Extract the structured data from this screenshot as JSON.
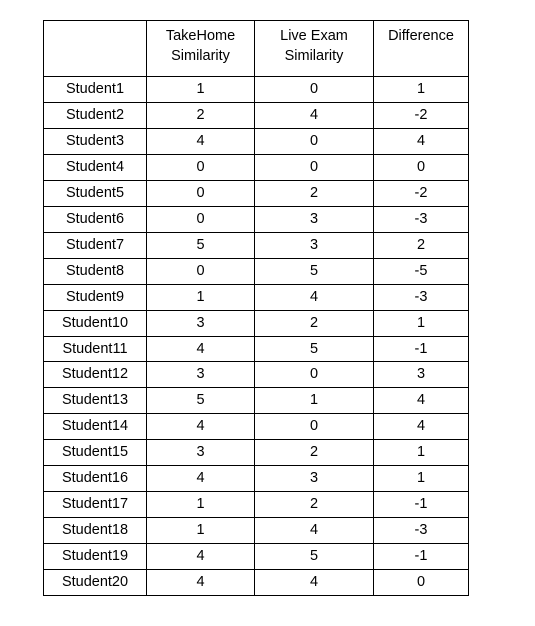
{
  "table": {
    "columns": [
      {
        "id": "student",
        "header_lines": []
      },
      {
        "id": "takehome",
        "header_lines": [
          "TakeHome",
          "Similarity"
        ]
      },
      {
        "id": "live_exam",
        "header_lines": [
          "Live Exam",
          "Similarity"
        ]
      },
      {
        "id": "difference",
        "header_lines": [
          "Difference"
        ]
      }
    ],
    "header": {
      "col0": "",
      "col1_line1": "TakeHome",
      "col1_line2": "Similarity",
      "col2_line1": "Live Exam",
      "col2_line2": "Similarity",
      "col3_line1": "Difference"
    },
    "rows": [
      {
        "student": "Student1",
        "takehome": "1",
        "live_exam": "0",
        "difference": "1"
      },
      {
        "student": "Student2",
        "takehome": "2",
        "live_exam": "4",
        "difference": "-2"
      },
      {
        "student": "Student3",
        "takehome": "4",
        "live_exam": "0",
        "difference": "4"
      },
      {
        "student": "Student4",
        "takehome": "0",
        "live_exam": "0",
        "difference": "0"
      },
      {
        "student": "Student5",
        "takehome": "0",
        "live_exam": "2",
        "difference": "-2"
      },
      {
        "student": "Student6",
        "takehome": "0",
        "live_exam": "3",
        "difference": "-3"
      },
      {
        "student": "Student7",
        "takehome": "5",
        "live_exam": "3",
        "difference": "2"
      },
      {
        "student": "Student8",
        "takehome": "0",
        "live_exam": "5",
        "difference": "-5"
      },
      {
        "student": "Student9",
        "takehome": "1",
        "live_exam": "4",
        "difference": "-3"
      },
      {
        "student": "Student10",
        "takehome": "3",
        "live_exam": "2",
        "difference": "1"
      },
      {
        "student": "Student11",
        "takehome": "4",
        "live_exam": "5",
        "difference": "-1"
      },
      {
        "student": "Student12",
        "takehome": "3",
        "live_exam": "0",
        "difference": "3"
      },
      {
        "student": "Student13",
        "takehome": "5",
        "live_exam": "1",
        "difference": "4"
      },
      {
        "student": "Student14",
        "takehome": "4",
        "live_exam": "0",
        "difference": "4"
      },
      {
        "student": "Student15",
        "takehome": "3",
        "live_exam": "2",
        "difference": "1"
      },
      {
        "student": "Student16",
        "takehome": "4",
        "live_exam": "3",
        "difference": "1"
      },
      {
        "student": "Student17",
        "takehome": "1",
        "live_exam": "2",
        "difference": "-1"
      },
      {
        "student": "Student18",
        "takehome": "1",
        "live_exam": "4",
        "difference": "-3"
      },
      {
        "student": "Student19",
        "takehome": "4",
        "live_exam": "5",
        "difference": "-1"
      },
      {
        "student": "Student20",
        "takehome": "4",
        "live_exam": "4",
        "difference": "0"
      }
    ]
  },
  "chart_data": {
    "type": "table",
    "title": "",
    "columns": [
      "",
      "TakeHome Similarity",
      "Live Exam Similarity",
      "Difference"
    ],
    "categories": [
      "Student1",
      "Student2",
      "Student3",
      "Student4",
      "Student5",
      "Student6",
      "Student7",
      "Student8",
      "Student9",
      "Student10",
      "Student11",
      "Student12",
      "Student13",
      "Student14",
      "Student15",
      "Student16",
      "Student17",
      "Student18",
      "Student19",
      "Student20"
    ],
    "series": [
      {
        "name": "TakeHome Similarity",
        "values": [
          1,
          2,
          4,
          0,
          0,
          0,
          5,
          0,
          1,
          3,
          4,
          3,
          5,
          4,
          3,
          4,
          1,
          1,
          4,
          4
        ]
      },
      {
        "name": "Live Exam Similarity",
        "values": [
          0,
          4,
          0,
          0,
          2,
          3,
          3,
          5,
          4,
          2,
          5,
          0,
          1,
          0,
          2,
          3,
          2,
          4,
          5,
          4
        ]
      },
      {
        "name": "Difference",
        "values": [
          1,
          -2,
          4,
          0,
          -2,
          -3,
          2,
          -5,
          -3,
          1,
          -1,
          3,
          4,
          4,
          1,
          1,
          -1,
          -3,
          -1,
          0
        ]
      }
    ]
  },
  "style": {
    "border_color": "#000000",
    "text_color": "#000000",
    "background": "#ffffff"
  }
}
